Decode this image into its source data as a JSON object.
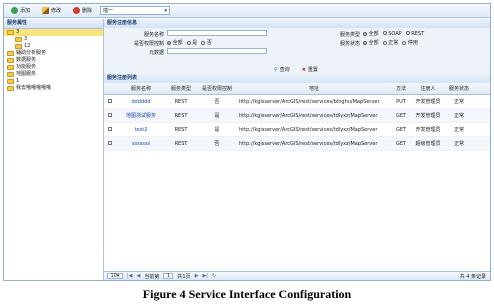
{
  "toolbar": {
    "add_label": "添加",
    "edit_label": "修改",
    "delete_label": "删除",
    "select_value": "插一"
  },
  "tree": {
    "title": "服务属性",
    "items": [
      {
        "label": "3",
        "level": 0,
        "selected": true
      },
      {
        "label": "3",
        "level": 1
      },
      {
        "label": "12",
        "level": 1
      },
      {
        "label": "辅助分析服务",
        "level": 0
      },
      {
        "label": "数据服务",
        "level": 0
      },
      {
        "label": "功能服务",
        "level": 0
      },
      {
        "label": "地图服务",
        "level": 0
      },
      {
        "label": "1",
        "level": 0
      },
      {
        "label": "我去哦哦哦哦哦",
        "level": 0
      }
    ]
  },
  "form": {
    "title": "服务注册信息",
    "service_name_label": "服务名称",
    "permission_label": "是否权限控制",
    "permission_options": [
      "全部",
      "是",
      "否"
    ],
    "metadata_label": "元数据",
    "service_type_label": "服务类型",
    "service_type_options": [
      "全部",
      "SOAP",
      "REST"
    ],
    "service_status_label": "服务状态",
    "service_status_options": [
      "全部",
      "正常",
      "停用"
    ],
    "query_label": "查询",
    "reset_label": "重置"
  },
  "grid": {
    "title": "服务注册列表",
    "columns": [
      "服务名称",
      "服务类型",
      "是否权限控制",
      "地址",
      "方法",
      "注册人",
      "服务状态"
    ],
    "rows": [
      [
        "dddddd",
        "REST",
        "否",
        "http://kgisserver/ArcGIS/rest/services/binghu/MapServer",
        "PUT",
        "开发管理员",
        "正常"
      ],
      [
        "地图测试服务",
        "REST",
        "是",
        "http://kgisserver/ArcGIS/rest/services/tdlyxz/MapServer",
        "GET",
        "开发管理员",
        "正常"
      ],
      [
        "test2",
        "REST",
        "是",
        "http://kgisserver/ArcGIS/rest/services/tdlyxz/MapServer",
        "GET",
        "开发管理员",
        "正常"
      ],
      [
        "sssssss",
        "REST",
        "否",
        "http://kgisserver/ArcGIS/rest/services/tdlyxz/MapServer",
        "GET",
        "超级管理员",
        "正常"
      ]
    ]
  },
  "pager": {
    "page_size": "10",
    "page_prefix": "当前第",
    "page_value": "1",
    "page_suffix": "共1页",
    "total": "共 4 条记录"
  },
  "caption": "Figure 4 Service Interface Configuration",
  "colors": {
    "accent": "#1d3f72",
    "selected": "#fbe47c",
    "link": "#1a45a8"
  }
}
